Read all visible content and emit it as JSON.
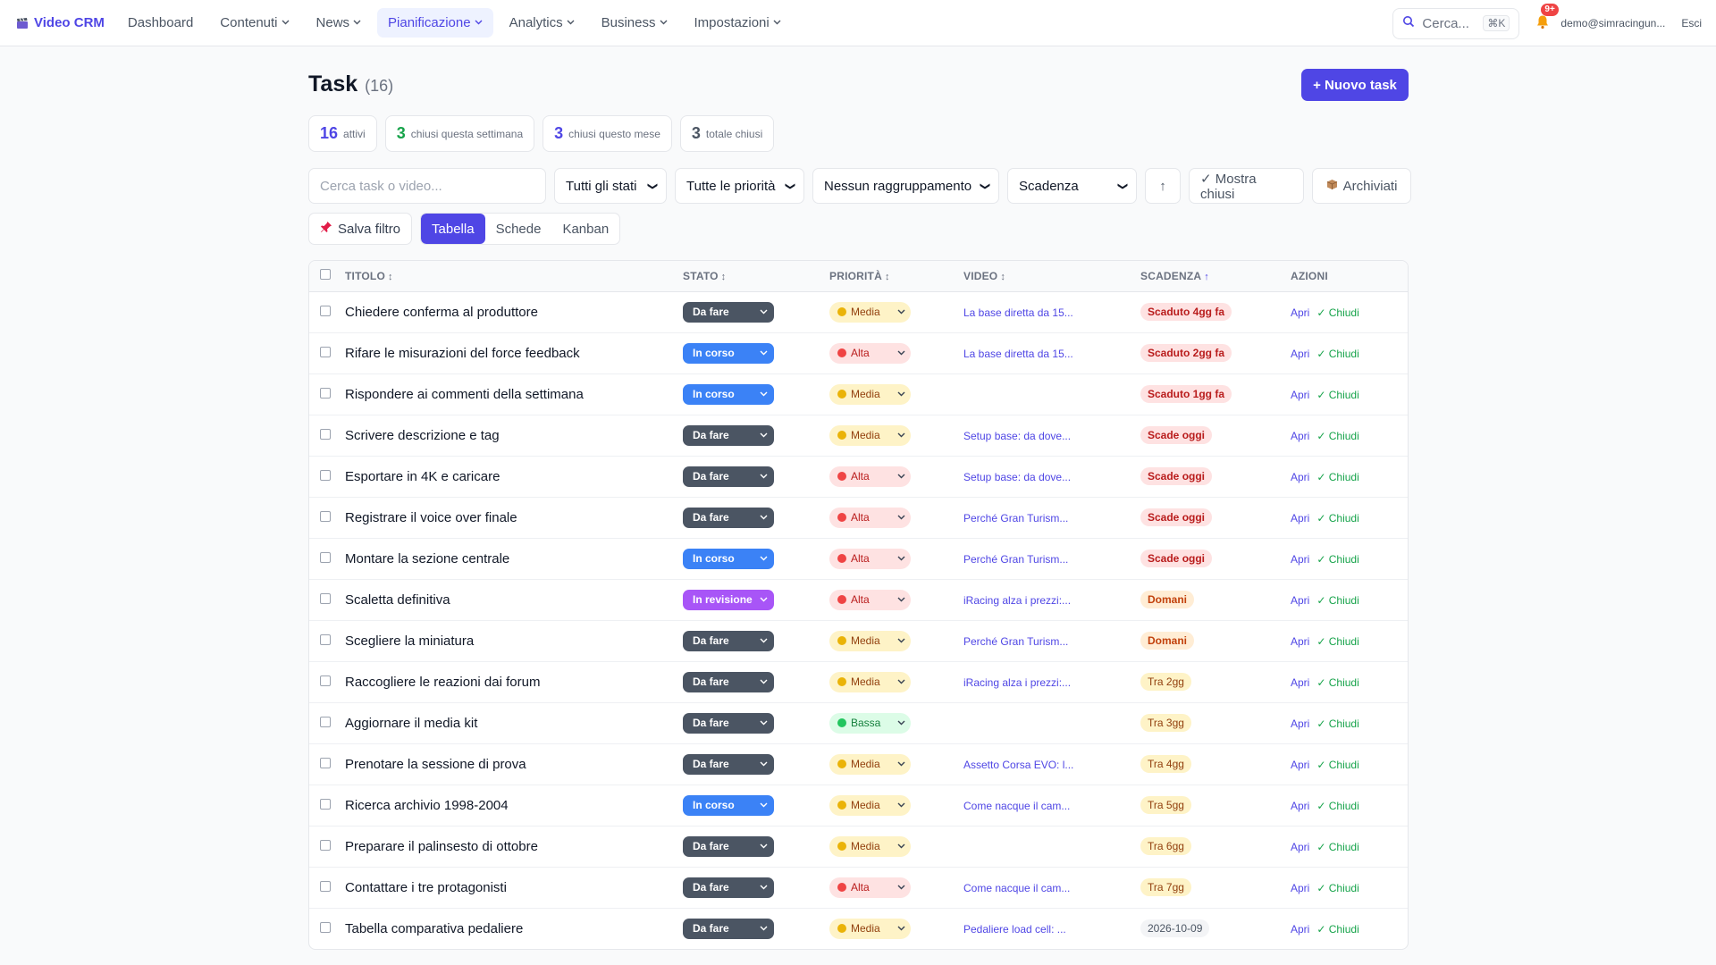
{
  "nav": {
    "brand": "Video CRM",
    "items": [
      {
        "label": "Dashboard",
        "dropdown": false,
        "active": false
      },
      {
        "label": "Contenuti",
        "dropdown": true,
        "active": false
      },
      {
        "label": "News",
        "dropdown": true,
        "active": false
      },
      {
        "label": "Pianificazione",
        "dropdown": true,
        "active": true
      },
      {
        "label": "Analytics",
        "dropdown": true,
        "active": false
      },
      {
        "label": "Business",
        "dropdown": true,
        "active": false
      },
      {
        "label": "Impostazioni",
        "dropdown": true,
        "active": false
      }
    ],
    "search_label": "Cerca...",
    "search_shortcut": "⌘K",
    "notifications_badge": "9+",
    "user_email": "demo@simracingun...",
    "logout_label": "Esci"
  },
  "page": {
    "title": "Task",
    "count": "(16)",
    "new_task_label": "+ Nuovo task"
  },
  "stats": [
    {
      "value": "16",
      "label": "attivi",
      "color": "#4f46e5"
    },
    {
      "value": "3",
      "label": "chiusi questa settimana",
      "color": "#16a34a"
    },
    {
      "value": "3",
      "label": "chiusi questo mese",
      "color": "#4f46e5"
    },
    {
      "value": "3",
      "label": "totale chiusi",
      "color": "#4b5563"
    }
  ],
  "filters": {
    "search_placeholder": "Cerca task o video...",
    "state_value": "Tutti gli stati",
    "priority_value": "Tutte le priorità",
    "group_value": "Nessun raggruppamento",
    "sort_value": "Scadenza",
    "sort_direction_icon": "↑",
    "show_closed_label": "✓ Mostra chiusi",
    "archived_label": "Archiviati",
    "save_filter_label": "Salva filtro"
  },
  "views": {
    "table": "Tabella",
    "cards": "Schede",
    "kanban": "Kanban",
    "active": "Tabella"
  },
  "table": {
    "headers": {
      "title": "TITOLO",
      "state": "STATO",
      "priority": "PRIORITÀ",
      "video": "VIDEO",
      "due": "SCADENZA",
      "actions": "AZIONI"
    },
    "open_label": "Apri",
    "close_label": "✓ Chiudi",
    "state_colors": {
      "Da fare": "#4b5563",
      "In corso": "#3b82f6",
      "In revisione": "#a855f7"
    },
    "priority_styles": {
      "Media": {
        "bg": "#fef3c7",
        "dot": "#eab308",
        "text": "#92400e"
      },
      "Alta": {
        "bg": "#fee2e2",
        "dot": "#ef4444",
        "text": "#b91c1c"
      },
      "Bassa": {
        "bg": "#dcfce7",
        "dot": "#22c55e",
        "text": "#15803d"
      }
    },
    "rows": [
      {
        "title": "Chiedere conferma al produttore",
        "state": "Da fare",
        "priority": "Media",
        "video": "La base diretta da 15...",
        "due": "Scaduto 4gg fa",
        "due_kind": "overdue"
      },
      {
        "title": "Rifare le misurazioni del force feedback",
        "state": "In corso",
        "priority": "Alta",
        "video": "La base diretta da 15...",
        "due": "Scaduto 2gg fa",
        "due_kind": "overdue"
      },
      {
        "title": "Rispondere ai commenti della settimana",
        "state": "In corso",
        "priority": "Media",
        "video": "",
        "due": "Scaduto 1gg fa",
        "due_kind": "overdue"
      },
      {
        "title": "Scrivere descrizione e tag",
        "state": "Da fare",
        "priority": "Media",
        "video": "Setup base: da dove...",
        "due": "Scade oggi",
        "due_kind": "today"
      },
      {
        "title": "Esportare in 4K e caricare",
        "state": "Da fare",
        "priority": "Alta",
        "video": "Setup base: da dove...",
        "due": "Scade oggi",
        "due_kind": "today"
      },
      {
        "title": "Registrare il voice over finale",
        "state": "Da fare",
        "priority": "Alta",
        "video": "Perché Gran Turism...",
        "due": "Scade oggi",
        "due_kind": "today"
      },
      {
        "title": "Montare la sezione centrale",
        "state": "In corso",
        "priority": "Alta",
        "video": "Perché Gran Turism...",
        "due": "Scade oggi",
        "due_kind": "today"
      },
      {
        "title": "Scaletta definitiva",
        "state": "In revisione",
        "priority": "Alta",
        "video": "iRacing alza i prezzi:...",
        "due": "Domani",
        "due_kind": "tomorrow"
      },
      {
        "title": "Scegliere la miniatura",
        "state": "Da fare",
        "priority": "Media",
        "video": "Perché Gran Turism...",
        "due": "Domani",
        "due_kind": "tomorrow"
      },
      {
        "title": "Raccogliere le reazioni dai forum",
        "state": "Da fare",
        "priority": "Media",
        "video": "iRacing alza i prezzi:...",
        "due": "Tra 2gg",
        "due_kind": "soon"
      },
      {
        "title": "Aggiornare il media kit",
        "state": "Da fare",
        "priority": "Bassa",
        "video": "",
        "due": "Tra 3gg",
        "due_kind": "soon"
      },
      {
        "title": "Prenotare la sessione di prova",
        "state": "Da fare",
        "priority": "Media",
        "video": "Assetto Corsa EVO: l...",
        "due": "Tra 4gg",
        "due_kind": "soon"
      },
      {
        "title": "Ricerca archivio 1998-2004",
        "state": "In corso",
        "priority": "Media",
        "video": "Come nacque il cam...",
        "due": "Tra 5gg",
        "due_kind": "soon"
      },
      {
        "title": "Preparare il palinsesto di ottobre",
        "state": "Da fare",
        "priority": "Media",
        "video": "",
        "due": "Tra 6gg",
        "due_kind": "soon"
      },
      {
        "title": "Contattare i tre protagonisti",
        "state": "Da fare",
        "priority": "Alta",
        "video": "Come nacque il cam...",
        "due": "Tra 7gg",
        "due_kind": "soon"
      },
      {
        "title": "Tabella comparativa pedaliere",
        "state": "Da fare",
        "priority": "Media",
        "video": "Pedaliere load cell: ...",
        "due": "2026-10-09",
        "due_kind": "date"
      }
    ]
  }
}
